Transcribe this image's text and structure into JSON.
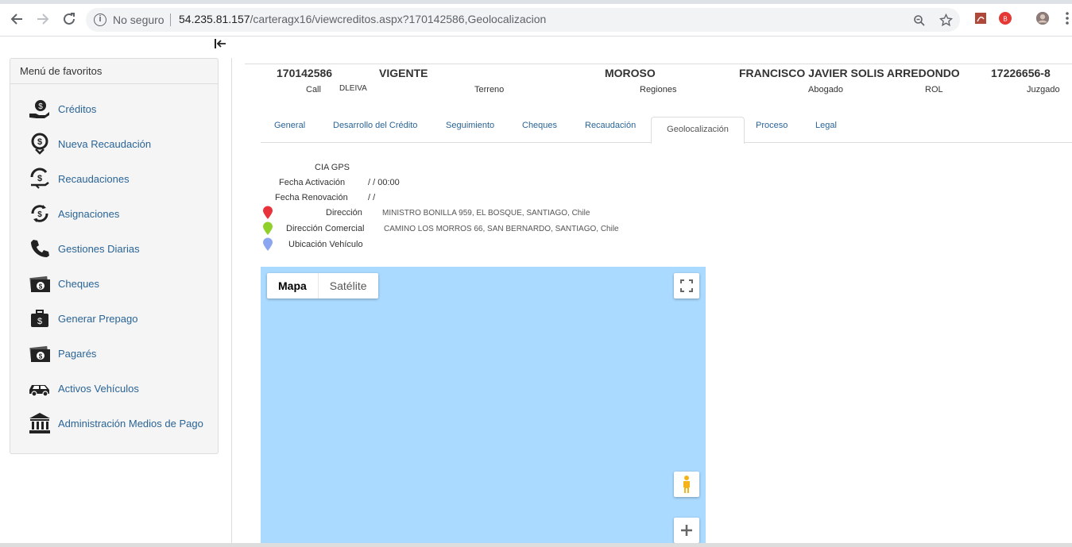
{
  "browser": {
    "security_label": "No seguro",
    "url_host": "54.235.81.157",
    "url_path": "/carteragx16/viewcreditos.aspx?170142586,Geolocalizacion"
  },
  "sidebar": {
    "title": "Menú de favoritos",
    "items": [
      {
        "label": "Créditos",
        "icon": "credit-hand-icon"
      },
      {
        "label": "Nueva Recaudación",
        "icon": "new-collection-icon"
      },
      {
        "label": "Recaudaciones",
        "icon": "collections-icon"
      },
      {
        "label": "Asignaciones",
        "icon": "assignments-icon"
      },
      {
        "label": "Gestiones Diarias",
        "icon": "phone-icon"
      },
      {
        "label": "Cheques",
        "icon": "cheque-icon"
      },
      {
        "label": "Generar Prepago",
        "icon": "briefcase-money-icon"
      },
      {
        "label": "Pagarés",
        "icon": "promissory-note-icon"
      },
      {
        "label": "Activos Vehículos",
        "icon": "car-icon"
      },
      {
        "label": "Administración Medios de Pago",
        "icon": "bank-icon"
      }
    ]
  },
  "header": {
    "credit_number": "170142586",
    "status": "VIGENTE",
    "debtor_status": "MOROSO",
    "client_name": "FRANCISCO JAVIER SOLIS ARREDONDO",
    "rut": "17226656-8",
    "labels": {
      "call": "Call",
      "call_value": "DLEIVA",
      "terreno": "Terreno",
      "regiones": "Regiones",
      "abogado": "Abogado",
      "rol": "ROL",
      "juzgado": "Juzgado"
    }
  },
  "tabs": [
    {
      "label": "General"
    },
    {
      "label": "Desarrollo del Crédito"
    },
    {
      "label": "Seguimiento"
    },
    {
      "label": "Cheques"
    },
    {
      "label": "Recaudación"
    },
    {
      "label": "Geolocalización",
      "active": true
    },
    {
      "label": "Proceso"
    },
    {
      "label": "Legal"
    }
  ],
  "geo": {
    "cia_gps_label": "CIA GPS",
    "cia_gps_value": "",
    "activation_label": "Fecha Activación",
    "activation_value": "/ / 00:00",
    "renewal_label": "Fecha Renovación",
    "renewal_value": "/ /",
    "address_label": "Dirección",
    "address_value": "MINISTRO BONILLA 959, EL BOSQUE, SANTIAGO, Chile",
    "commercial_label": "Dirección Comercial",
    "commercial_value": "CAMINO LOS MORROS 66, SAN BERNARDO, SANTIAGO, Chile",
    "vehicle_label": "Ubicación Vehículo",
    "pin_colors": {
      "address": "#e8323c",
      "commercial": "#8fd12a",
      "vehicle": "#8aa6f0"
    }
  },
  "map": {
    "type_map": "Mapa",
    "type_satellite": "Satélite",
    "water_color": "#aadaff"
  }
}
